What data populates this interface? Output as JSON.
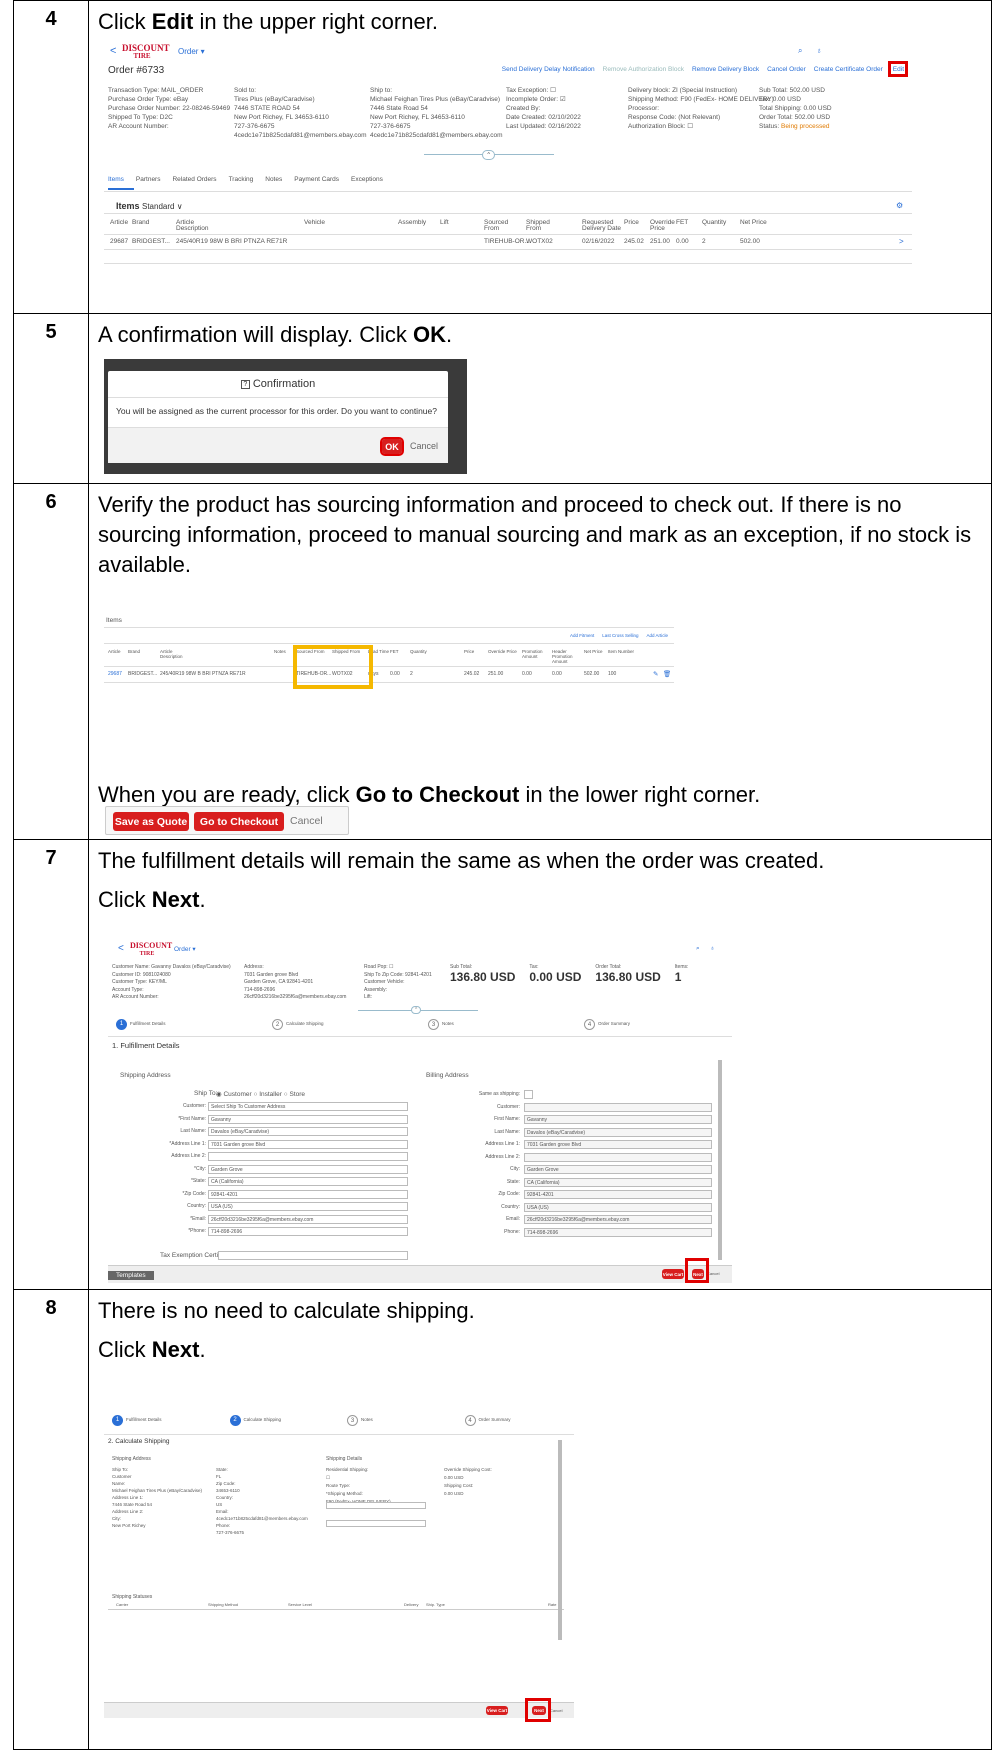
{
  "steps": [
    {
      "num": "4",
      "text_pre": "Click ",
      "text_bold": "Edit",
      "text_post": " in the upper right corner.",
      "shot": {
        "logo_top": "DISCOUNT",
        "logo_bottom": "TIRE",
        "order_menu": "Order ▾",
        "order_no": "Order #6733",
        "actions": [
          "Send Delivery Delay Notification",
          "Remove Authorization Block",
          "Remove Delivery Block",
          "Cancel Order",
          "Create Certificate Order",
          "Edit"
        ],
        "col1": [
          "Transaction Type: MAIL_ORDER",
          "Purchase Order Type: eBay",
          "Purchase Order Number: 22-08246-59469",
          "Shipped To Type: D2C",
          "AR Account Number:"
        ],
        "col2": [
          "Sold to:",
          "Tires Plus (eBay/Caradvise)",
          "7446 STATE ROAD 54",
          "New Port Richey, FL 34653-6110",
          "727-376-6675",
          "4cedc1e71b825cdafd81@members.ebay.com"
        ],
        "col3": [
          "Ship to:",
          "Michael Feighan Tires Plus (eBay/Caradvise)",
          "7446 State Road 54",
          "New Port Richey, FL 34653-6110",
          "727-376-6675",
          "4cedc1e71b825cdafd81@members.ebay.com"
        ],
        "col4": [
          "Tax Exception: ☐",
          "Incomplete Order: ☑",
          "Created By:",
          "Date Created: 02/10/2022",
          "Last Updated: 02/16/2022"
        ],
        "col5": [
          "Delivery block: ZI (Special Instruction)",
          "Shipping Method: F90 (FedEx- HOME DELIVERY)",
          "Processor:",
          "Response Code: (Not Relevant)",
          "Authorization Block: ☐"
        ],
        "col6": [
          "Sub Total: 502.00 USD",
          "Tax: 0.00 USD",
          "Total Shipping: 0.00 USD",
          "Order Total: 502.00 USD"
        ],
        "status_label": "Status:",
        "status_value": "Being processed",
        "tabs": [
          "Items",
          "Partners",
          "Related Orders",
          "Tracking",
          "Notes",
          "Payment Cards",
          "Exceptions"
        ],
        "items_title": "Items",
        "items_view": "Standard ∨",
        "headers": [
          "Article",
          "Brand",
          "Article Description",
          "Vehicle",
          "Assembly",
          "Lift",
          "Sourced From",
          "Shipped From",
          "Requested Delivery Date",
          "Price",
          "Override Price",
          "FET",
          "Quantity",
          "Net Price"
        ],
        "row": [
          "29687",
          "BRIDGEST...",
          "245/40R19 98W B BRI PTNZA RE71R",
          "",
          "",
          "",
          "TIREHUB-OR...",
          "WOTX02",
          "02/16/2022",
          "245.02",
          "251.00",
          "0.00",
          "2",
          "502.00"
        ]
      }
    },
    {
      "num": "5",
      "text_pre": "A confirmation will display. Click ",
      "text_bold": "OK",
      "text_post": ".",
      "dialog": {
        "title": "Confirmation",
        "message": "You will be assigned as the current processor for this order. Do you want to continue?",
        "ok": "OK",
        "cancel": "Cancel"
      }
    },
    {
      "num": "6",
      "text": "Verify the product has sourcing information and proceed to check out. If there is no sourcing information, proceed to manual sourcing and mark as an exception, if no stock is available.",
      "text2_pre": "When you are ready, click ",
      "text2_bold": "Go to Checkout",
      "text2_post": " in the lower right corner.",
      "cart": {
        "section": "Items",
        "links": [
          "Add Fitment",
          "Last Cross Selling",
          "Add Article"
        ],
        "headers": [
          "Article",
          "Brand",
          "Article Description",
          "Notes",
          "Sourced From",
          "Shipped From",
          "Lead Time",
          "FET",
          "Quantity",
          "Price",
          "Override Price",
          "Promotion Amount",
          "Header Promotion Amount",
          "Net Price",
          "Item Number"
        ],
        "row": [
          "29687",
          "BRIDGEST...",
          "245/40R19 98W B BRI PTNZA RE71R",
          "",
          "TIREHUB-OR...",
          "WOTX02",
          "days",
          "0.00",
          "2",
          "245.02",
          "251.00",
          "0.00",
          "0.00",
          "502.00",
          "100"
        ]
      },
      "buttons": {
        "quote": "Save as Quote",
        "checkout": "Go to Checkout",
        "cancel": "Cancel"
      }
    },
    {
      "num": "7",
      "text": "The fulfillment details will remain the same as when the order was created.",
      "text2_pre": "Click ",
      "text2_bold": "Next",
      "text2_post": ".",
      "shot": {
        "meta": [
          "Customer Name: Gavanny Davalos (eBay/Caradvise)",
          "Customer ID: 9081024080",
          "Customer Type: KEY/ML",
          "Account Type:",
          "AR Account Number:"
        ],
        "address": [
          "Address:",
          "7031 Garden grove Blvd",
          "Garden Grove, CA 92841-4201",
          "714-898-2696",
          "26cff20d3216be3295f6a@members.ebay.com"
        ],
        "misc": [
          "Road Pop: ☐",
          "Ship To Zip Code: 92841-4201",
          "Customer Vehicle:",
          "Assembly:",
          "Lift:"
        ],
        "totals": [
          {
            "label": "Sub Total:",
            "value": "136.80 USD"
          },
          {
            "label": "Tax:",
            "value": "0.00 USD"
          },
          {
            "label": "Order Total:",
            "value": "136.80 USD"
          },
          {
            "label": "Items:",
            "value": "1"
          }
        ],
        "wizard": [
          "Fulfillment Details",
          "Calculate Shipping",
          "Notes",
          "Order Summary"
        ],
        "section": "1. Fulfillment Details",
        "shipping_title": "Shipping Address",
        "billing_title": "Billing Address",
        "ship_to_label": "Ship To:",
        "ship_to_options": "◉ Customer  ○ Installer  ○ Store",
        "ship_fields": [
          {
            "label": "Customer:",
            "value": "Select Ship To Customer Address"
          },
          {
            "label": "*First Name:",
            "value": "Gavanny"
          },
          {
            "label": "Last Name:",
            "value": "Davalos (eBay/Caradvise)"
          },
          {
            "label": "*Address Line 1:",
            "value": "7031 Garden grove Blvd"
          },
          {
            "label": "Address Line 2:",
            "value": ""
          },
          {
            "label": "*City:",
            "value": "Garden Grove"
          },
          {
            "label": "*State:",
            "value": "CA (California)"
          },
          {
            "label": "*Zip Code:",
            "value": "92841-4201"
          },
          {
            "label": "Country:",
            "value": "USA (US)"
          },
          {
            "label": "*Email:",
            "value": "26cff20d3216be3295f6a@members.ebay.com"
          },
          {
            "label": "*Phone:",
            "value": "714-898-2696"
          }
        ],
        "tax_cert": "Tax Exemption Certificate:",
        "bill_fields": [
          {
            "label": "Same as shipping:",
            "value": ""
          },
          {
            "label": "Customer:",
            "value": ""
          },
          {
            "label": "First Name:",
            "value": "Gavanny"
          },
          {
            "label": "Last Name:",
            "value": "Davalos (eBay/Caradvise)"
          },
          {
            "label": "Address Line 1:",
            "value": "7031 Garden grove Blvd"
          },
          {
            "label": "Address Line 2:",
            "value": ""
          },
          {
            "label": "City:",
            "value": "Garden Grove"
          },
          {
            "label": "State:",
            "value": "CA (California)"
          },
          {
            "label": "Zip Code:",
            "value": "92841-4201"
          },
          {
            "label": "Country:",
            "value": "USA (US)"
          },
          {
            "label": "Email:",
            "value": "26cff20d3216be3295f6a@members.ebay.com"
          },
          {
            "label": "Phone:",
            "value": "714-898-2696"
          }
        ],
        "view_cart": "View Cart",
        "next": "Next",
        "cancel": "Cancel",
        "templates": "Templates"
      }
    },
    {
      "num": "8",
      "text": "There is no need to calculate shipping.",
      "text2_pre": "Click ",
      "text2_bold": "Next",
      "text2_post": ".",
      "shot": {
        "wizard": [
          "Fulfillment Details",
          "Calculate Shipping",
          "Notes",
          "Order Summary"
        ],
        "section": "2. Calculate Shipping",
        "ship_addr_title": "Shipping Address",
        "ship_details_title": "Shipping Details",
        "left": [
          "Ship To:",
          "Customer",
          "Name:",
          "Michael Feighan Tires Plus (eBay/Caradvise)",
          "Address Line 1:",
          "7446 State Road 54",
          "Address Line 2:",
          "City:",
          "New Port Richey"
        ],
        "mid": [
          "State:",
          "FL",
          "Zip Code:",
          "34653-6110",
          "Country:",
          "US",
          "Email:",
          "4cedc1e71b825cdafd81@members.ebay.com",
          "Phone:",
          "727-376-6675"
        ],
        "details": [
          "Residential Shipping:",
          "☐",
          "Route Type:",
          "*Shipping Method:",
          "F90 (FedEx- HOME DELIVERY)"
        ],
        "right": [
          "Override Shipping Cost:",
          "0.00  USD",
          "Shipping Cost:",
          "0.00  USD"
        ],
        "status_title": "Shipping Statuses",
        "status_cols": [
          "Carrier",
          "Shipping Method",
          "Service Level",
          "Delivery",
          "Ship. Type",
          "Rate"
        ],
        "view_cart": "View Cart",
        "next": "Next",
        "cancel": "Cancel"
      }
    }
  ]
}
